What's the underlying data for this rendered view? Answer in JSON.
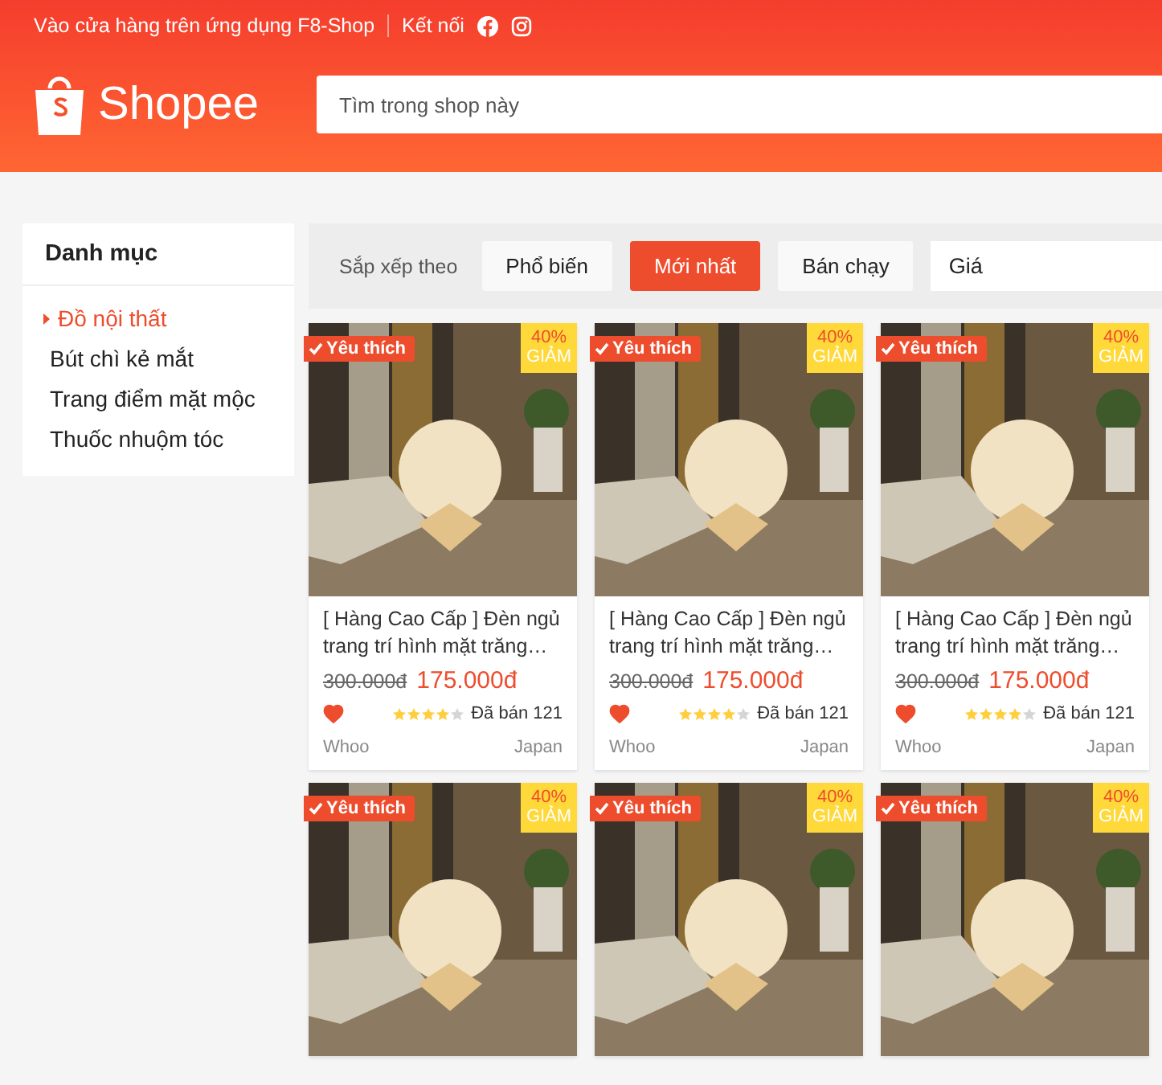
{
  "topbar": {
    "app_link": "Vào cửa hàng trên ứng dụng F8-Shop",
    "connect": "Kết nối"
  },
  "header": {
    "logo_text": "Shopee",
    "search": {
      "placeholder": "Tìm trong shop này"
    }
  },
  "sidebar": {
    "title": "Danh mục",
    "items": [
      {
        "label": "Đồ nội thất",
        "selected": true
      },
      {
        "label": "Bút chì kẻ mắt",
        "selected": false
      },
      {
        "label": "Trang điểm mặt mộc",
        "selected": false
      },
      {
        "label": "Thuốc nhuộm tóc",
        "selected": false
      }
    ]
  },
  "sort_bar": {
    "label": "Sắp xếp theo",
    "options": [
      {
        "label": "Phổ biến",
        "selected": false
      },
      {
        "label": "Mới nhất",
        "selected": true
      },
      {
        "label": "Bán chạy",
        "selected": false
      }
    ],
    "price_select": "Giá"
  },
  "products": [
    {
      "favorite_badge": "Yêu thích",
      "discount": "40%",
      "discount_label": "GIẢM",
      "name": "[ Hàng Cao Cấp ] Đèn ngủ trang trí hình mặt trăng…",
      "old_price": "300.000đ",
      "price": "175.000đ",
      "liked": true,
      "stars": 4,
      "sold": "Đã bán 121",
      "brand": "Whoo",
      "origin": "Japan"
    },
    {
      "favorite_badge": "Yêu thích",
      "discount": "40%",
      "discount_label": "GIẢM",
      "name": "[ Hàng Cao Cấp ] Đèn ngủ trang trí hình mặt trăng…",
      "old_price": "300.000đ",
      "price": "175.000đ",
      "liked": true,
      "stars": 4,
      "sold": "Đã bán 121",
      "brand": "Whoo",
      "origin": "Japan"
    },
    {
      "favorite_badge": "Yêu thích",
      "discount": "40%",
      "discount_label": "GIẢM",
      "name": "[ Hàng Cao Cấp ] Đèn ngủ trang trí hình mặt trăng…",
      "old_price": "300.000đ",
      "price": "175.000đ",
      "liked": true,
      "stars": 4,
      "sold": "Đã bán 121",
      "brand": "Whoo",
      "origin": "Japan"
    },
    {
      "favorite_badge": "Yêu thích",
      "discount": "40%",
      "discount_label": "GIẢM"
    },
    {
      "favorite_badge": "Yêu thích",
      "discount": "40%",
      "discount_label": "GIẢM"
    },
    {
      "favorite_badge": "Yêu thích",
      "discount": "40%",
      "discount_label": "GIẢM"
    }
  ]
}
